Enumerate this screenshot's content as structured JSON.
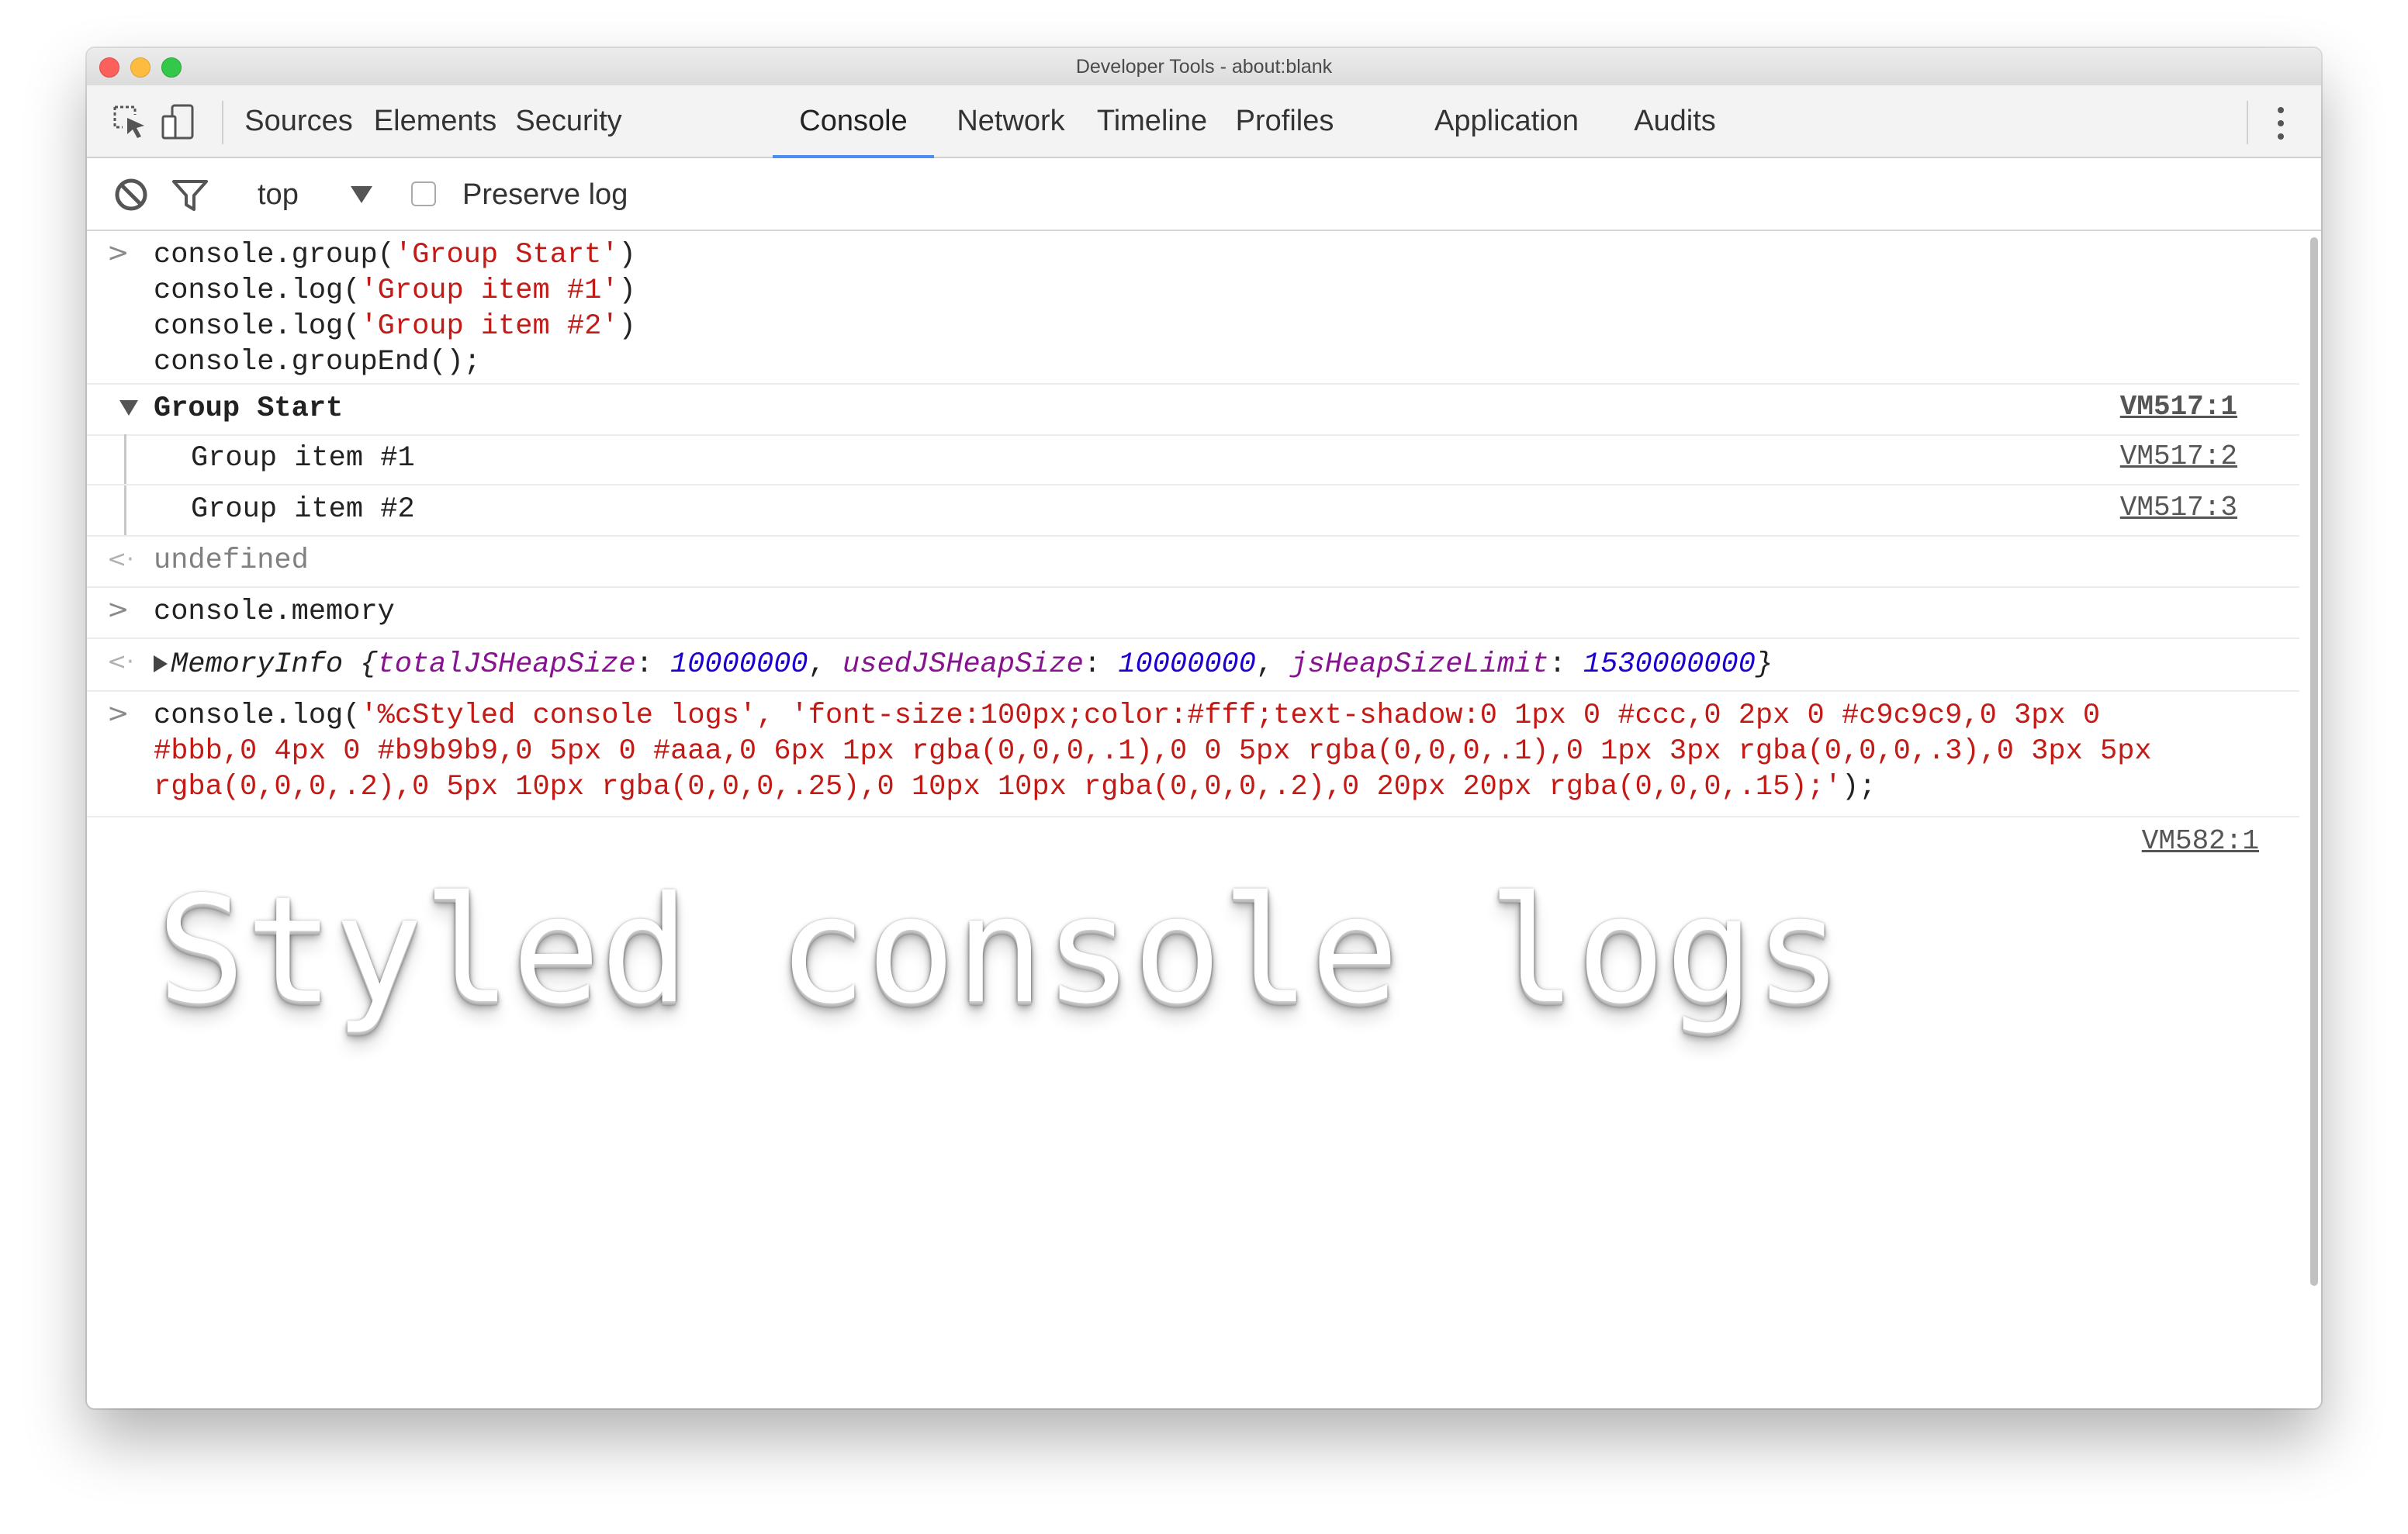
{
  "window": {
    "title": "Developer Tools - about:blank"
  },
  "tabs": [
    {
      "label": "Sources",
      "active": false
    },
    {
      "label": "Elements",
      "active": false
    },
    {
      "label": "Security",
      "active": false
    },
    {
      "label": "Console",
      "active": true
    },
    {
      "label": "Network",
      "active": false
    },
    {
      "label": "Timeline",
      "active": false
    },
    {
      "label": "Profiles",
      "active": false
    },
    {
      "label": "Application",
      "active": false
    },
    {
      "label": "Audits",
      "active": false
    }
  ],
  "toolbar_icons": [
    "inspect-element-icon",
    "device-toolbar-icon",
    "more-options-icon"
  ],
  "console_toolbar": {
    "context": "top",
    "preserve_log_label": "Preserve log",
    "preserve_log_checked": false,
    "icons": [
      "clear-console-icon",
      "filter-icon",
      "dropdown-arrow-icon"
    ]
  },
  "console": {
    "group_input": {
      "line1_pre": "console.group(",
      "line1_str": "'Group Start'",
      "line1_post": ")",
      "line2_pre": "console.log(",
      "line2_str": "'Group item #1'",
      "line2_post": ")",
      "line3_pre": "console.log(",
      "line3_str": "'Group item #2'",
      "line3_post": ")",
      "line4": "console.groupEnd();"
    },
    "group_header": {
      "label": "Group Start",
      "source": "VM517:1"
    },
    "group_items": [
      {
        "text": "Group item #1",
        "source": "VM517:2"
      },
      {
        "text": "Group item #2",
        "source": "VM517:3"
      }
    ],
    "undefined_result": "undefined",
    "memory_input": "console.memory",
    "memory_output": {
      "name": "MemoryInfo",
      "open": "{",
      "k1": "totalJSHeapSize",
      "v1": "10000000",
      "k2": "usedJSHeapSize",
      "v2": "10000000",
      "k3": "jsHeapSizeLimit",
      "v3": "1530000000",
      "close": "}",
      "colon": ": ",
      "comma": ", "
    },
    "styled_input": {
      "pre": "console.log(",
      "line1_str": "'%cStyled console logs', 'font-size:100px;color:#fff;text-shadow:0 1px 0 #ccc,0 2px 0 #c9c9c9,0 3px 0",
      "line2_str": "#bbb,0 4px 0 #b9b9b9,0 5px 0 #aaa,0 6px 1px rgba(0,0,0,.1),0 0 5px rgba(0,0,0,.1),0 1px 3px rgba(0,0,0,.3),0 3px 5px",
      "line3_str": "rgba(0,0,0,.2),0 5px 10px rgba(0,0,0,.25),0 10px 10px rgba(0,0,0,.2),0 20px 20px rgba(0,0,0,.15);'",
      "post": ");"
    },
    "styled_output": {
      "text": "Styled console logs",
      "source": "VM582:1"
    }
  },
  "colors": {
    "accent": "#4a8cf0",
    "string": "#c41a16",
    "property": "#881391",
    "number": "#1c00cf"
  }
}
